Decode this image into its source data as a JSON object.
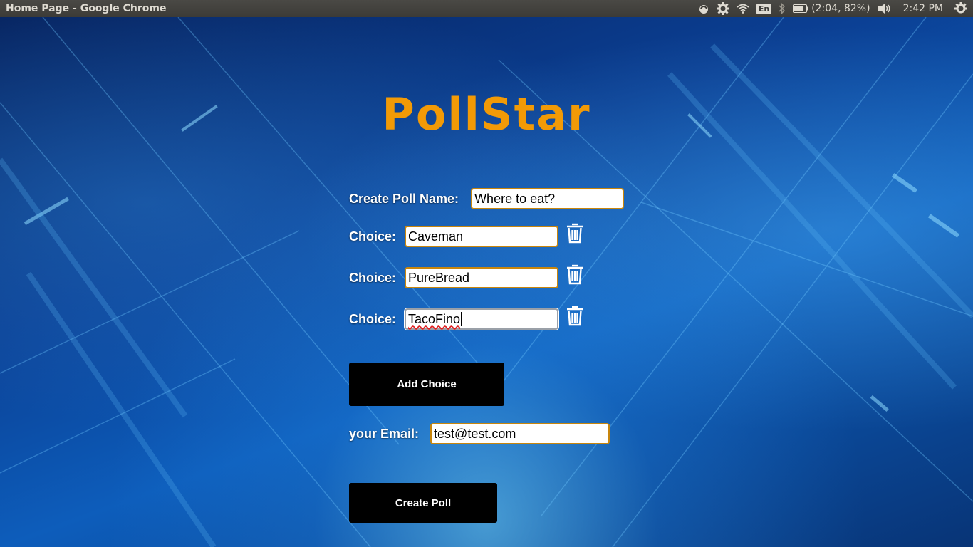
{
  "window": {
    "title": "Home Page - Google Chrome"
  },
  "tray": {
    "keyboard_layout": "En",
    "battery": "(2:04, 82%)",
    "clock": "2:42 PM",
    "icons": [
      "network-sync-icon",
      "settings-icon",
      "wifi-icon",
      "bluetooth-icon",
      "battery-icon",
      "volume-icon",
      "power-icon"
    ]
  },
  "app": {
    "logo": "PollStar",
    "poll_name_label": "Create Poll Name:",
    "poll_name_value": "Where to eat?",
    "choice_label": "Choice:",
    "choices": [
      "Caveman",
      "PureBread",
      "TacoFino"
    ],
    "add_choice_label": "Add Choice",
    "email_label": "your Email:",
    "email_value": "test@test.com",
    "create_poll_label": "Create Poll"
  },
  "colors": {
    "accent": "#f29a06",
    "field_border": "#c8860d",
    "button_bg": "#000000"
  }
}
